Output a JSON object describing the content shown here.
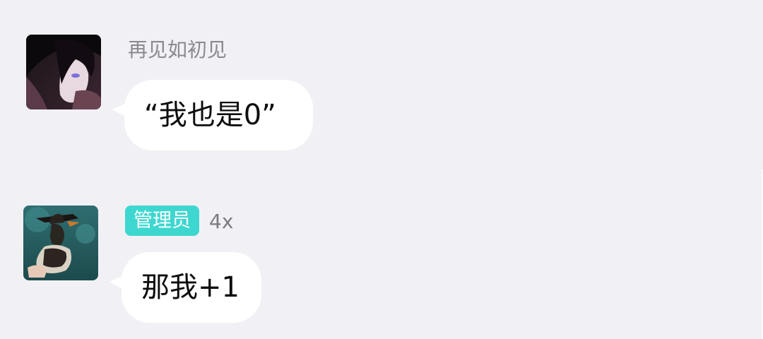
{
  "messages": [
    {
      "sender": "再见如初见",
      "text": "“我也是0”",
      "avatar_icon": "dark-hair-character-avatar-icon"
    },
    {
      "role_badge": "管理员",
      "level": "4x",
      "text": "那我+1",
      "avatar_icon": "hat-character-avatar-icon"
    }
  ],
  "colors": {
    "background": "#f1f1f5",
    "bubble": "#ffffff",
    "badge": "#3ed7d0",
    "name_text": "#8a8a8e"
  }
}
